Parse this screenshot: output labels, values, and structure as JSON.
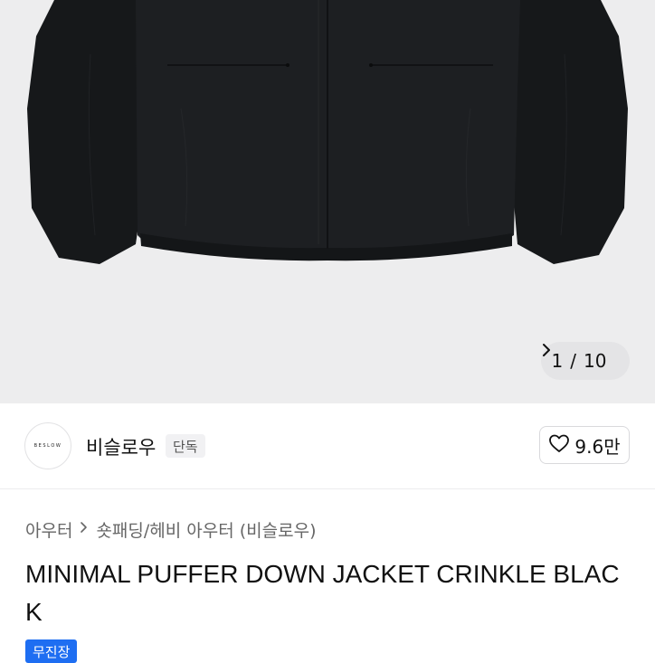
{
  "gallery": {
    "image_alt": "black puffer down jacket",
    "pager_current": "1",
    "pager_separator": "/",
    "pager_total": "10",
    "next_icon": "chevron-right-icon"
  },
  "brand": {
    "logo_text": "BESLOW",
    "name": "비슬로우",
    "badge": "단독",
    "like_count": "9.6만",
    "like_icon": "heart-icon"
  },
  "breadcrumb": {
    "category": "아우터",
    "subcategory": "숏패딩/헤비 아우터 (비슬로우)"
  },
  "product": {
    "title": "MINIMAL PUFFER DOWN JACKET CRINKLE BLACK",
    "tag": "무진장"
  },
  "colors": {
    "background_image": "#ededee",
    "jacket": "#1d1f22",
    "tag": "#1e6ef2"
  }
}
